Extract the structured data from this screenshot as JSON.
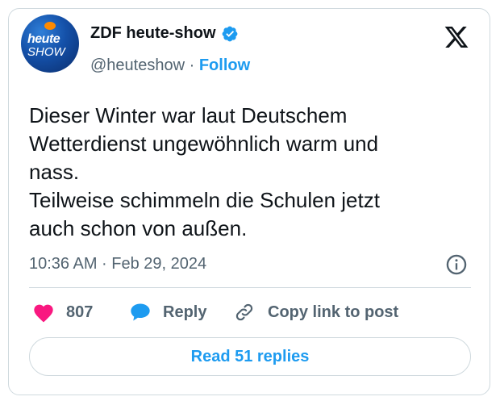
{
  "author": {
    "name": "ZDF heute-show",
    "handle": "@heuteshow",
    "separator": "·",
    "follow_label": "Follow",
    "avatar_text_line1": "heute",
    "avatar_text_line2": "SHOW",
    "verified_color": "#1d9bf0"
  },
  "tweet": {
    "text": "Dieser Winter war laut Deutschem\nWetterdienst ungewöhnlich warm und\nnass.\nTeilweise schimmeln die Schulen jetzt\nauch schon von außen.",
    "timestamp": "10:36 AM · Feb 29, 2024"
  },
  "actions": {
    "likes_count": "807",
    "reply_label": "Reply",
    "copy_link_label": "Copy link to post"
  },
  "footer": {
    "read_replies_label": "Read 51 replies"
  },
  "colors": {
    "accent": "#1d9bf0",
    "like": "#f91880",
    "muted": "#536471",
    "border": "#cfd9de"
  }
}
